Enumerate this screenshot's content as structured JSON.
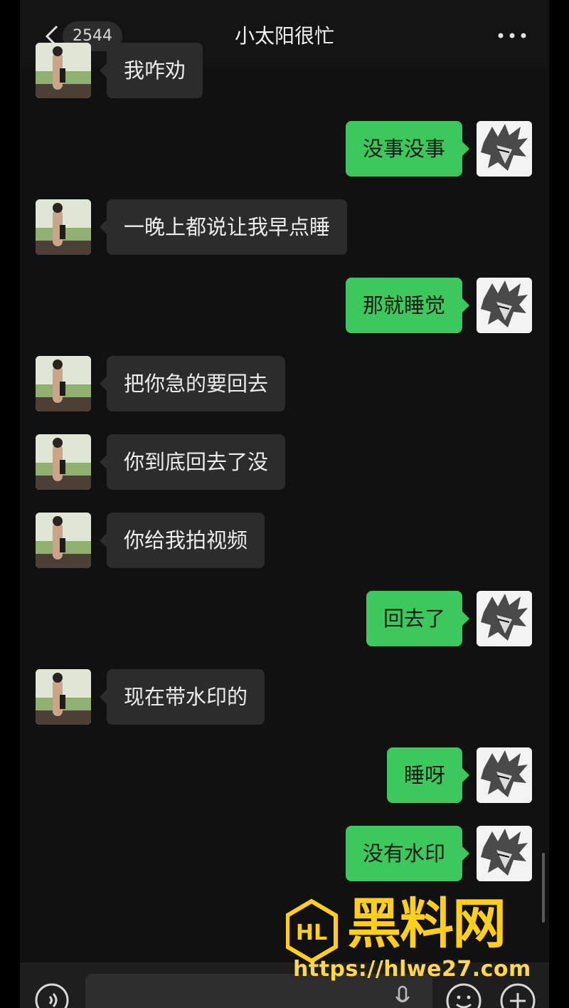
{
  "header": {
    "back_icon": "chevron-left-icon",
    "unread_count": "2544",
    "title": "小太阳很忙",
    "more_icon": "ellipsis-icon"
  },
  "messages": [
    {
      "side": "in",
      "text": "我咋劝"
    },
    {
      "side": "out",
      "text": "没事没事"
    },
    {
      "side": "in",
      "text": "一晚上都说让我早点睡"
    },
    {
      "side": "out",
      "text": "那就睡觉"
    },
    {
      "side": "in",
      "text": "把你急的要回去"
    },
    {
      "side": "in",
      "text": "你到底回去了没"
    },
    {
      "side": "in",
      "text": "你给我拍视频"
    },
    {
      "side": "out",
      "text": "回去了"
    },
    {
      "side": "in",
      "text": "现在带水印的"
    },
    {
      "side": "out",
      "text": "睡呀"
    },
    {
      "side": "out",
      "text": "没有水印"
    }
  ],
  "input_bar": {
    "voice_icon": "voice-icon",
    "mic_icon": "microphone-icon",
    "emoji_icon": "emoji-icon",
    "plus_icon": "plus-icon"
  },
  "watermark": {
    "logo_text": "HL",
    "text": "黑料网",
    "url": "https://hlwe27.com"
  },
  "colors": {
    "background": "#111111",
    "outgoing_bubble": "#3cc85c",
    "incoming_bubble": "#2c2c2c",
    "watermark": "#ffcf1a"
  }
}
